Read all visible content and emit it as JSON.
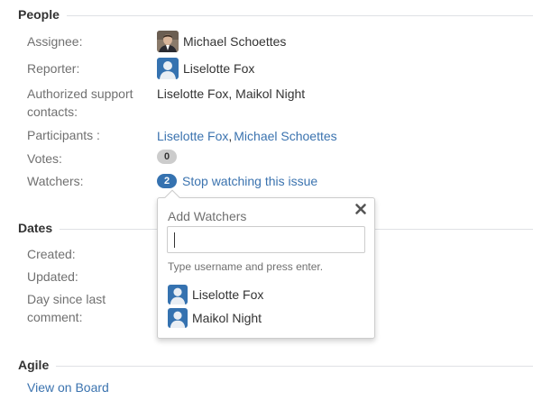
{
  "people": {
    "section_title": "People",
    "assignee": {
      "label": "Assignee:",
      "name": "Michael Schoettes"
    },
    "reporter": {
      "label": "Reporter:",
      "name": "Liselotte Fox"
    },
    "support": {
      "label_line1": "Authorized support",
      "label_line2": "contacts:",
      "value": "Liselotte Fox, Maikol Night"
    },
    "participants": {
      "label": "Participants :",
      "items": [
        "Liselotte Fox",
        "Michael Schoettes"
      ],
      "separator": ","
    },
    "votes": {
      "label": "Votes:",
      "count": "0"
    },
    "watchers": {
      "label": "Watchers:",
      "count": "2",
      "action": "Stop watching this issue"
    }
  },
  "dates": {
    "section_title": "Dates",
    "created_label": "Created:",
    "updated_label": "Updated:",
    "last_comment_line1": "Day since last",
    "last_comment_line2": "comment:"
  },
  "agile": {
    "section_title": "Agile",
    "view_on_board": "View on Board"
  },
  "add_watchers": {
    "title": "Add Watchers",
    "input_value": "",
    "hint": "Type username and press enter.",
    "suggestions": [
      "Liselotte Fox",
      "Maikol Night"
    ],
    "close_icon": "close-icon"
  },
  "colors": {
    "link": "#3b73af",
    "label": "#707070",
    "badge_blue": "#3572b0",
    "badge_grey": "#cccccc"
  }
}
